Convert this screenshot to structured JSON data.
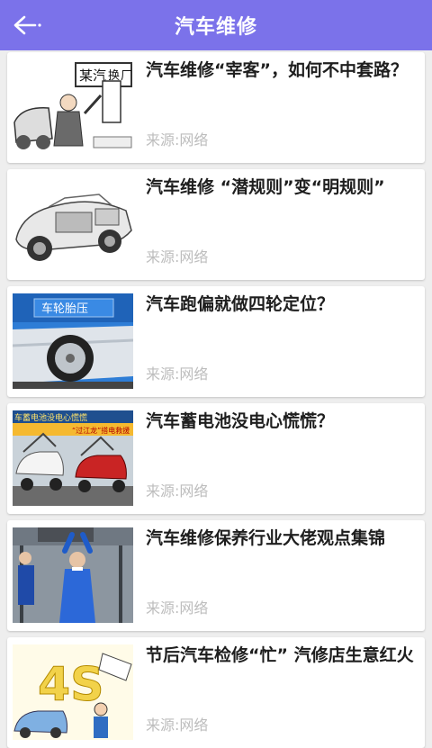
{
  "header": {
    "title": "汽车维修",
    "back_icon": "arrow-left-icon",
    "bg_color": "#7b72ea"
  },
  "articles": [
    {
      "title": "汽车维修“宰客”，如何不中套路？",
      "source": "来源:网络",
      "thumb_text": [
        "某汽",
        "换",
        "厂"
      ]
    },
    {
      "title": "汽车维修 “潜规则”变“明规则”",
      "source": "来源:网络"
    },
    {
      "title": "汽车跑偏就做四轮定位？",
      "source": "来源:网络",
      "thumb_text": [
        "车轮胎压"
      ]
    },
    {
      "title": "汽车蓄电池没电心慌慌？",
      "source": "来源:网络",
      "thumb_text": [
        "车蓄电池没电心慌慌",
        "“过江龙”搭电救援"
      ]
    },
    {
      "title": "汽车维修保养行业大佬观点集锦",
      "source": "来源:网络"
    },
    {
      "title": "节后汽车检修“忙” 汽修店生意红火",
      "source": "来源:网络",
      "thumb_text": [
        "4S"
      ]
    }
  ]
}
